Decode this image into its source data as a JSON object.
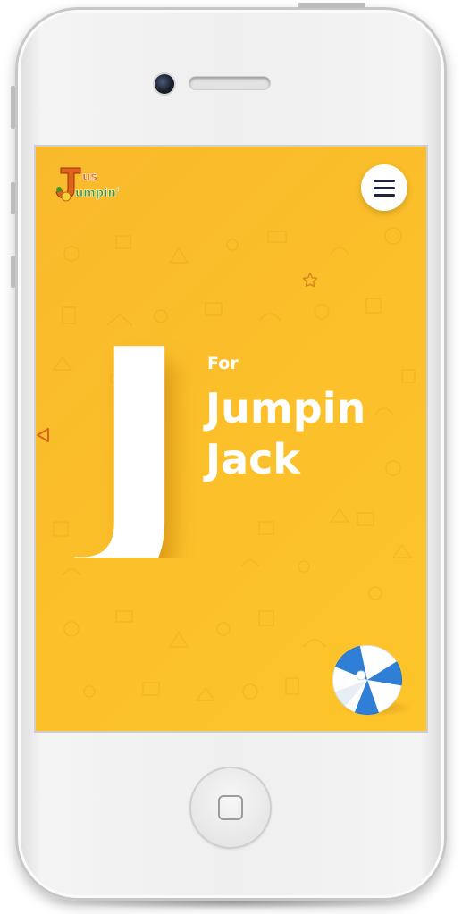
{
  "app": {
    "logo_text_top": "Jus",
    "logo_text_bottom": "Jumpin'"
  },
  "hero": {
    "letter": "J",
    "for_label": "For",
    "word_line_1": "Jumpin",
    "word_line_2": "Jack"
  },
  "icons": {
    "menu": "hamburger-menu-icon",
    "star": "star-icon",
    "triangle": "triangle-icon",
    "ball": "beach-ball-icon",
    "home": "home-button-icon"
  },
  "colors": {
    "screen_background": "#fbbf2a",
    "text": "#ffffff",
    "menu_bars": "#1e2340",
    "ball_blue": "#2f7fd6",
    "ball_white": "#ffffff",
    "star_outline": "#e08a10"
  }
}
